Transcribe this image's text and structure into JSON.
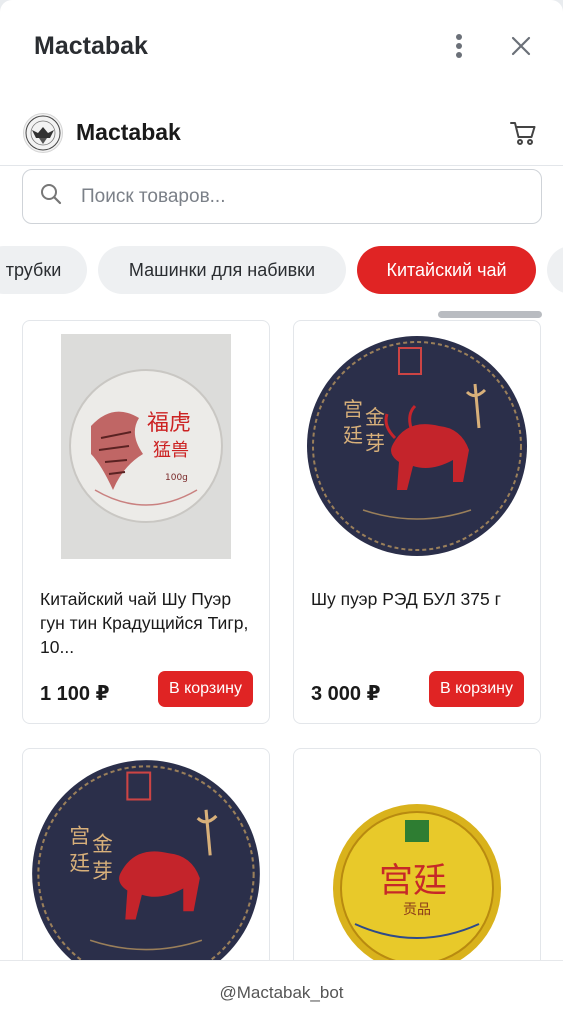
{
  "window": {
    "title": "Mactabak",
    "menu_icon": "more-vertical-icon",
    "close_icon": "close-icon"
  },
  "shop": {
    "name": "Mactabak",
    "logo": "mactabak-logo",
    "cart_icon": "cart-icon"
  },
  "search": {
    "placeholder": "Поиск товаров...",
    "value": "",
    "icon": "search-icon"
  },
  "categories": [
    {
      "label": "трубки",
      "active": false
    },
    {
      "label": "Машинки для набивки",
      "active": false
    },
    {
      "label": "Китайский чай",
      "active": true
    },
    {
      "label": "",
      "active": false
    }
  ],
  "products": [
    {
      "name": "Китайский чай Шу Пуэр гун тин Крадущийся Тигр, 10...",
      "price": "1 100 ₽",
      "button": "В корзину",
      "image": "tiger-tea-cake"
    },
    {
      "name": "Шу пуэр РЭД БУЛ 375 г",
      "price": "3 000 ₽",
      "button": "В корзину",
      "image": "red-bull-tea-cake"
    },
    {
      "name": "",
      "price": "",
      "button": "",
      "image": "red-bull-tea-cake"
    },
    {
      "name": "",
      "price": "",
      "button": "",
      "image": "yellow-tea-cake"
    }
  ],
  "footer": {
    "bot_handle": "@Mactabak_bot"
  },
  "colors": {
    "accent": "#e02424",
    "chip_bg": "#eef0f2",
    "tea_dark": "#2b2f4a"
  }
}
